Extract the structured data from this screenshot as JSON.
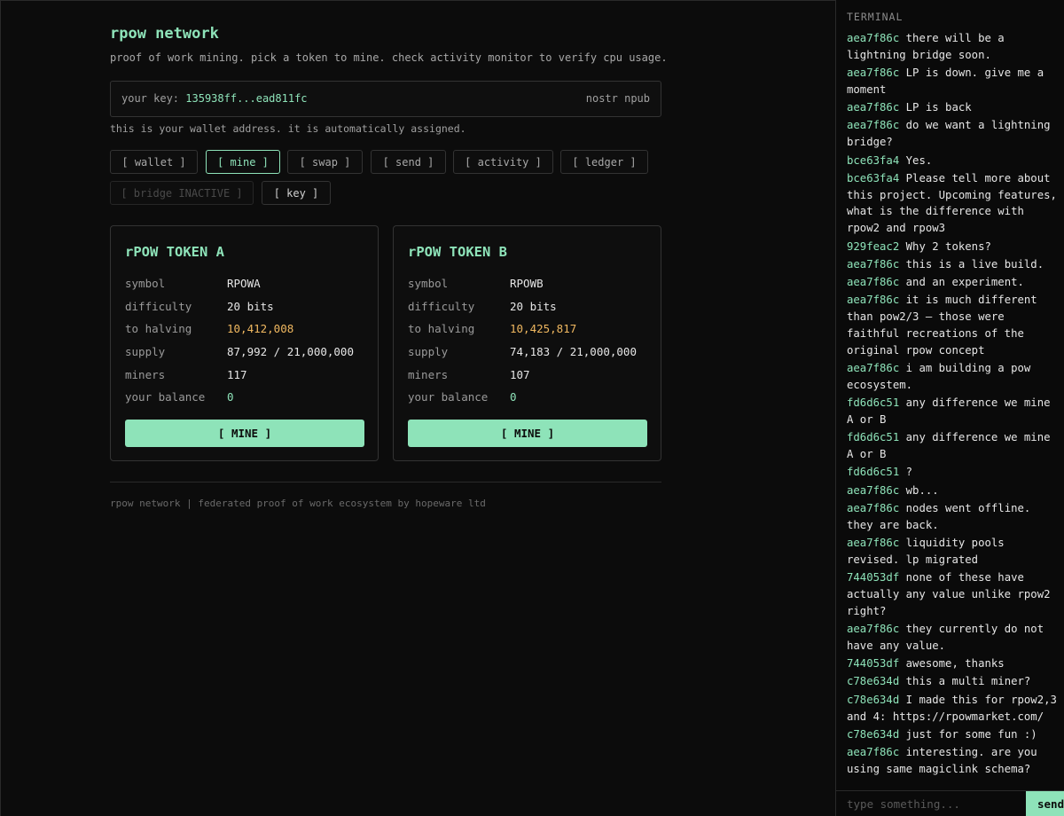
{
  "header": {
    "title": "rpow network",
    "subtitle": "proof of work mining. pick a token to mine. check activity monitor to verify cpu usage."
  },
  "key": {
    "label": "your key:",
    "value": "135938ff...ead811fc",
    "type": "nostr npub",
    "note": "this is your wallet address. it is automatically assigned."
  },
  "nav": [
    {
      "label": "[ wallet ]",
      "state": "normal"
    },
    {
      "label": "[ mine ]",
      "state": "active"
    },
    {
      "label": "[ swap ]",
      "state": "normal"
    },
    {
      "label": "[ send ]",
      "state": "normal"
    },
    {
      "label": "[ activity ]",
      "state": "normal"
    },
    {
      "label": "[ ledger ]",
      "state": "normal"
    },
    {
      "label": "[ bridge INACTIVE ]",
      "state": "disabled"
    },
    {
      "label": "[ key ]",
      "state": "normal"
    }
  ],
  "tokens": [
    {
      "title": "rPOW TOKEN A",
      "rows": [
        {
          "k": "symbol",
          "v": "RPOWA"
        },
        {
          "k": "difficulty",
          "v": "20 bits"
        },
        {
          "k": "to halving",
          "v": "10,412,008"
        },
        {
          "k": "supply",
          "v": "87,992 / 21,000,000"
        },
        {
          "k": "miners",
          "v": "117"
        },
        {
          "k": "your balance",
          "v": "0"
        }
      ],
      "button": "[ MINE ]"
    },
    {
      "title": "rPOW TOKEN B",
      "rows": [
        {
          "k": "symbol",
          "v": "RPOWB"
        },
        {
          "k": "difficulty",
          "v": "20 bits"
        },
        {
          "k": "to halving",
          "v": "10,425,817"
        },
        {
          "k": "supply",
          "v": "74,183 / 21,000,000"
        },
        {
          "k": "miners",
          "v": "107"
        },
        {
          "k": "your balance",
          "v": "0"
        }
      ],
      "button": "[ MINE ]"
    }
  ],
  "footer": "rpow network | federated proof of work ecosystem by hopeware ltd",
  "terminal": {
    "title": "TERMINAL",
    "messages": [
      {
        "who": "aea7f86c",
        "text": "there will be a lightning bridge soon."
      },
      {
        "who": "aea7f86c",
        "text": "LP is down. give me a moment"
      },
      {
        "who": "aea7f86c",
        "text": "LP is back"
      },
      {
        "who": "aea7f86c",
        "text": "do we want a lightning bridge?"
      },
      {
        "who": "bce63fa4",
        "text": "Yes."
      },
      {
        "who": "bce63fa4",
        "text": "Please tell more about this project. Upcoming features, what is the difference with rpow2 and rpow3"
      },
      {
        "who": "929feac2",
        "text": "Why 2 tokens?"
      },
      {
        "who": "aea7f86c",
        "text": "this is a live build."
      },
      {
        "who": "aea7f86c",
        "text": "and an experiment."
      },
      {
        "who": "aea7f86c",
        "text": "it is much different than pow2/3 – those were faithful recreations of the original rpow concept"
      },
      {
        "who": "aea7f86c",
        "text": "i am building a pow ecosystem."
      },
      {
        "who": "fd6d6c51",
        "text": "any difference we mine A or B"
      },
      {
        "who": "fd6d6c51",
        "text": "any difference we mine A or B"
      },
      {
        "who": "fd6d6c51",
        "text": "?"
      },
      {
        "who": "aea7f86c",
        "text": "wb..."
      },
      {
        "who": "aea7f86c",
        "text": "nodes went offline. they are back."
      },
      {
        "who": "aea7f86c",
        "text": "liquidity pools revised. lp migrated"
      },
      {
        "who": "744053df",
        "text": "none of these have actually any value unlike rpow2 right?"
      },
      {
        "who": "aea7f86c",
        "text": "they currently do not have any value."
      },
      {
        "who": "744053df",
        "text": "awesome, thanks"
      },
      {
        "who": "c78e634d",
        "text": "this a multi miner?"
      },
      {
        "who": "c78e634d",
        "text": "I made this for rpow2,3 and 4: https://rpowmarket.com/"
      },
      {
        "who": "c78e634d",
        "text": "just for some fun :)"
      },
      {
        "who": "aea7f86c",
        "text": "interesting. are you using same magiclink schema?"
      }
    ],
    "input_placeholder": "type something...",
    "send_label": "send"
  },
  "colors": {
    "background": "#0c0c0c",
    "accent": "#8ee3b9",
    "halving": "#f0b860",
    "muted": "#a0a0a0",
    "border": "#333333"
  }
}
